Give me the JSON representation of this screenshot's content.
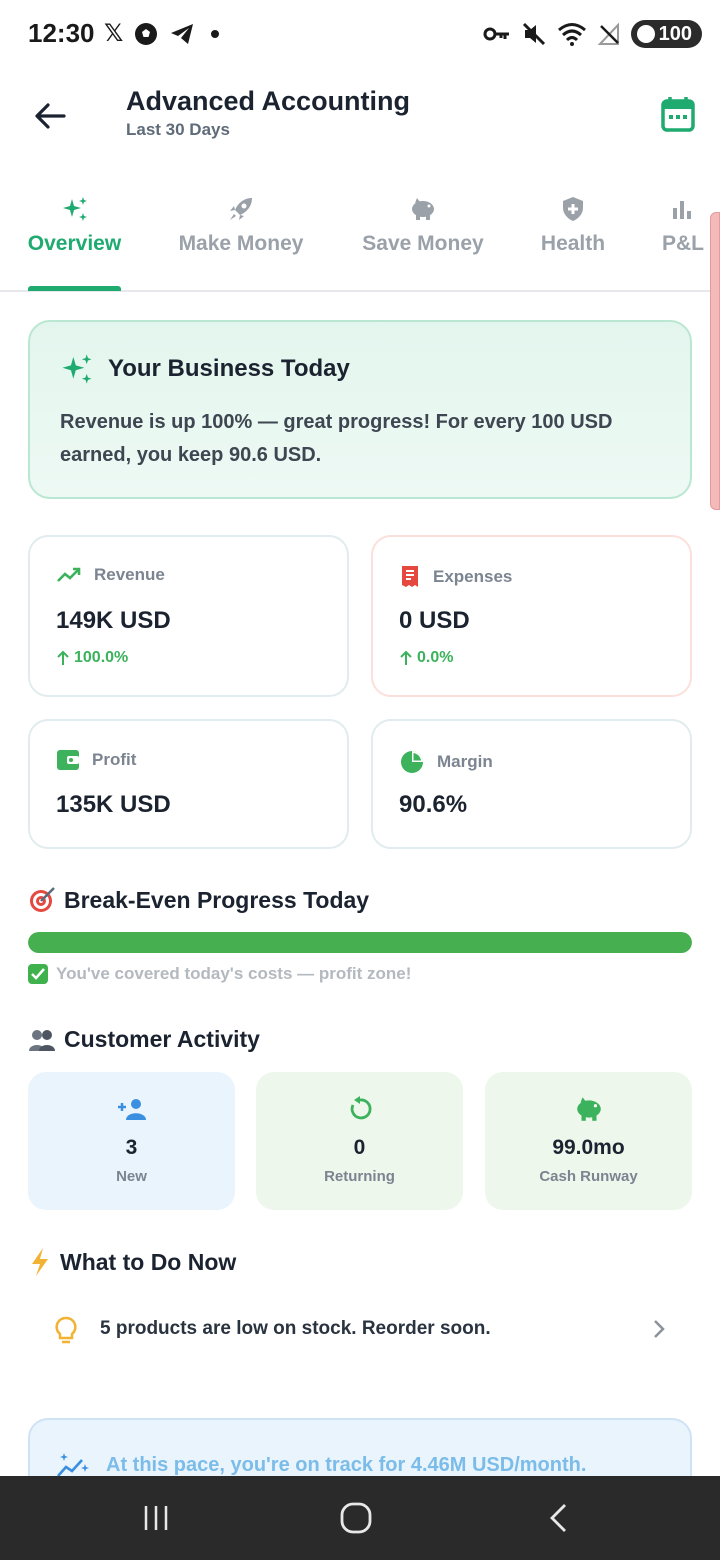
{
  "status_bar": {
    "time": "12:30",
    "left_icons": [
      "x-logo-icon",
      "soccer-ball-icon",
      "telegram-icon",
      "dot-icon"
    ],
    "right_icons": [
      "key-icon",
      "mute-icon",
      "wifi-icon",
      "no-signal-icon"
    ],
    "battery": "100"
  },
  "header": {
    "title": "Advanced Accounting",
    "subtitle": "Last 30 Days"
  },
  "tabs": [
    {
      "label": "Overview",
      "icon": "sparkles-icon",
      "active": true
    },
    {
      "label": "Make Money",
      "icon": "rocket-icon",
      "active": false
    },
    {
      "label": "Save Money",
      "icon": "piggy-bank-icon",
      "active": false
    },
    {
      "label": "Health",
      "icon": "shield-plus-icon",
      "active": false
    },
    {
      "label": "P&L",
      "icon": "bar-chart-icon",
      "active": false
    }
  ],
  "today": {
    "title": "Your Business Today",
    "text": "Revenue is up 100% — great progress! For every 100 USD earned, you keep 90.6 USD."
  },
  "metrics": {
    "revenue": {
      "label": "Revenue",
      "value": "149K USD",
      "change": "100.0%"
    },
    "expenses": {
      "label": "Expenses",
      "value": "0 USD",
      "change": "0.0%"
    },
    "profit": {
      "label": "Profit",
      "value": "135K USD"
    },
    "margin": {
      "label": "Margin",
      "value": "90.6%"
    }
  },
  "break_even": {
    "title": "Break-Even Progress Today",
    "progress": 1.0,
    "note": "You've covered today's costs — profit zone!"
  },
  "customers": {
    "title": "Customer Activity",
    "tiles": [
      {
        "value": "3",
        "label": "New"
      },
      {
        "value": "0",
        "label": "Returning"
      },
      {
        "value": "99.0mo",
        "label": "Cash Runway"
      }
    ]
  },
  "todo": {
    "title": "What to Do Now",
    "items": [
      {
        "text": "5 products are low on stock. Reorder soon."
      }
    ]
  },
  "forecast": {
    "text": "At this pace, you're on track for 4.46M USD/month."
  },
  "colors": {
    "accent": "#1faa6f",
    "positive": "#3bb25b",
    "expense": "#e5483f",
    "info": "#7bbce9"
  }
}
